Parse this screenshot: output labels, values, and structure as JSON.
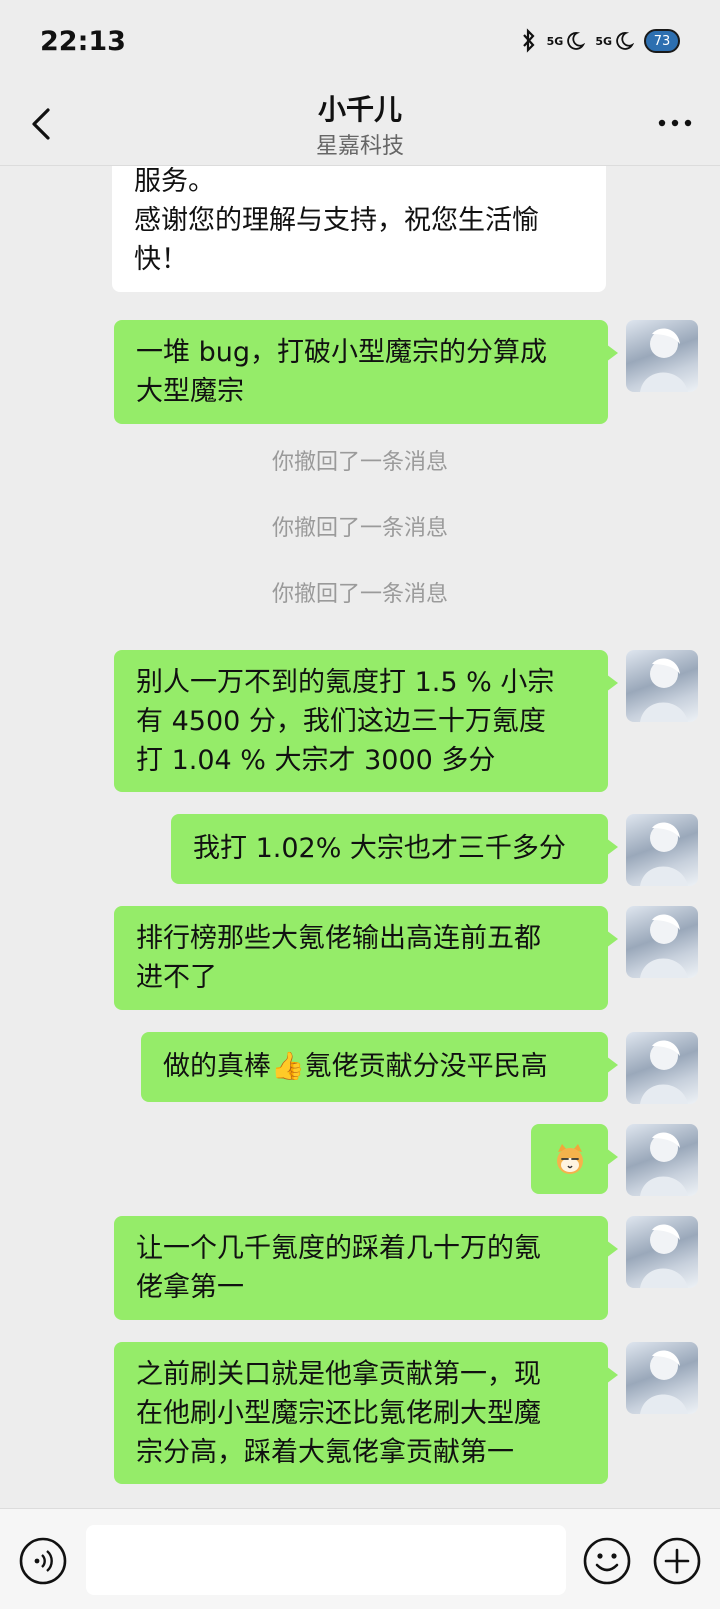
{
  "status_bar": {
    "time": "22:13",
    "signal_1": "5G",
    "signal_2": "5G",
    "battery": "73"
  },
  "header": {
    "title": "小千儿",
    "subtitle": "星嘉科技"
  },
  "messages": [
    {
      "type": "in",
      "lines": [
        "服务。",
        "感谢您的理解与支持，祝您生活愉",
        "快！"
      ]
    },
    {
      "type": "out",
      "lines": [
        "一堆 bug，打破小型魔宗的分算成",
        "大型魔宗"
      ]
    },
    {
      "type": "system",
      "text": "你撤回了一条消息"
    },
    {
      "type": "system",
      "text": "你撤回了一条消息"
    },
    {
      "type": "system",
      "text": "你撤回了一条消息"
    },
    {
      "type": "out",
      "lines": [
        "别人一万不到的氪度打 1.5 % 小宗",
        "有 4500 分，我们这边三十万氪度",
        "打 1.04 % 大宗才 3000 多分"
      ]
    },
    {
      "type": "out",
      "lines": [
        "我打 1.02% 大宗也才三千多分"
      ]
    },
    {
      "type": "out",
      "lines": [
        "排行榜那些大氪佬输出高连前五都",
        "进不了"
      ]
    },
    {
      "type": "out",
      "lines": [
        "做的真棒👍氪佬贡献分没平民高"
      ]
    },
    {
      "type": "out-emoji",
      "emoji": "🐱"
    },
    {
      "type": "out",
      "lines": [
        "让一个几千氪度的踩着几十万的氪",
        "佬拿第一"
      ]
    },
    {
      "type": "out",
      "lines": [
        "之前刷关口就是他拿贡献第一，现",
        "在他刷小型魔宗还比氪佬刷大型魔",
        "宗分高，踩着大氪佬拿贡献第一"
      ]
    }
  ],
  "input": {
    "placeholder": ""
  },
  "icons": {
    "back": "chevron-left-icon",
    "more": "more-dots-icon",
    "voice": "voice-icon",
    "emoji": "emoji-icon",
    "plus": "plus-icon"
  },
  "colors": {
    "outgoing_bubble": "#95ec69",
    "incoming_bubble": "#ffffff",
    "background": "#ededed"
  }
}
